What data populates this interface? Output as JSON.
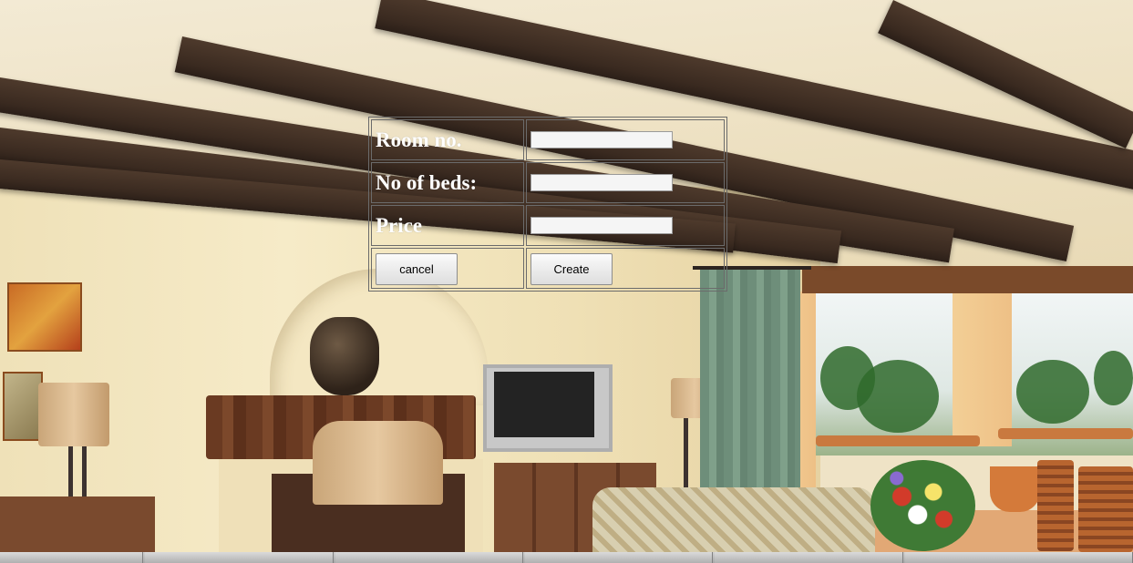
{
  "form": {
    "room_no_label": "Room no.",
    "beds_label": "No of beds:",
    "price_label": "Price",
    "room_no_value": "",
    "beds_value": "",
    "price_value": "",
    "cancel_label": "cancel",
    "create_label": "Create"
  },
  "colors": {
    "label_text": "#ffffff",
    "beam": "#3a2a20",
    "wall": "#f6ebc8"
  },
  "icons": {
    "background": "living-room-photo"
  }
}
